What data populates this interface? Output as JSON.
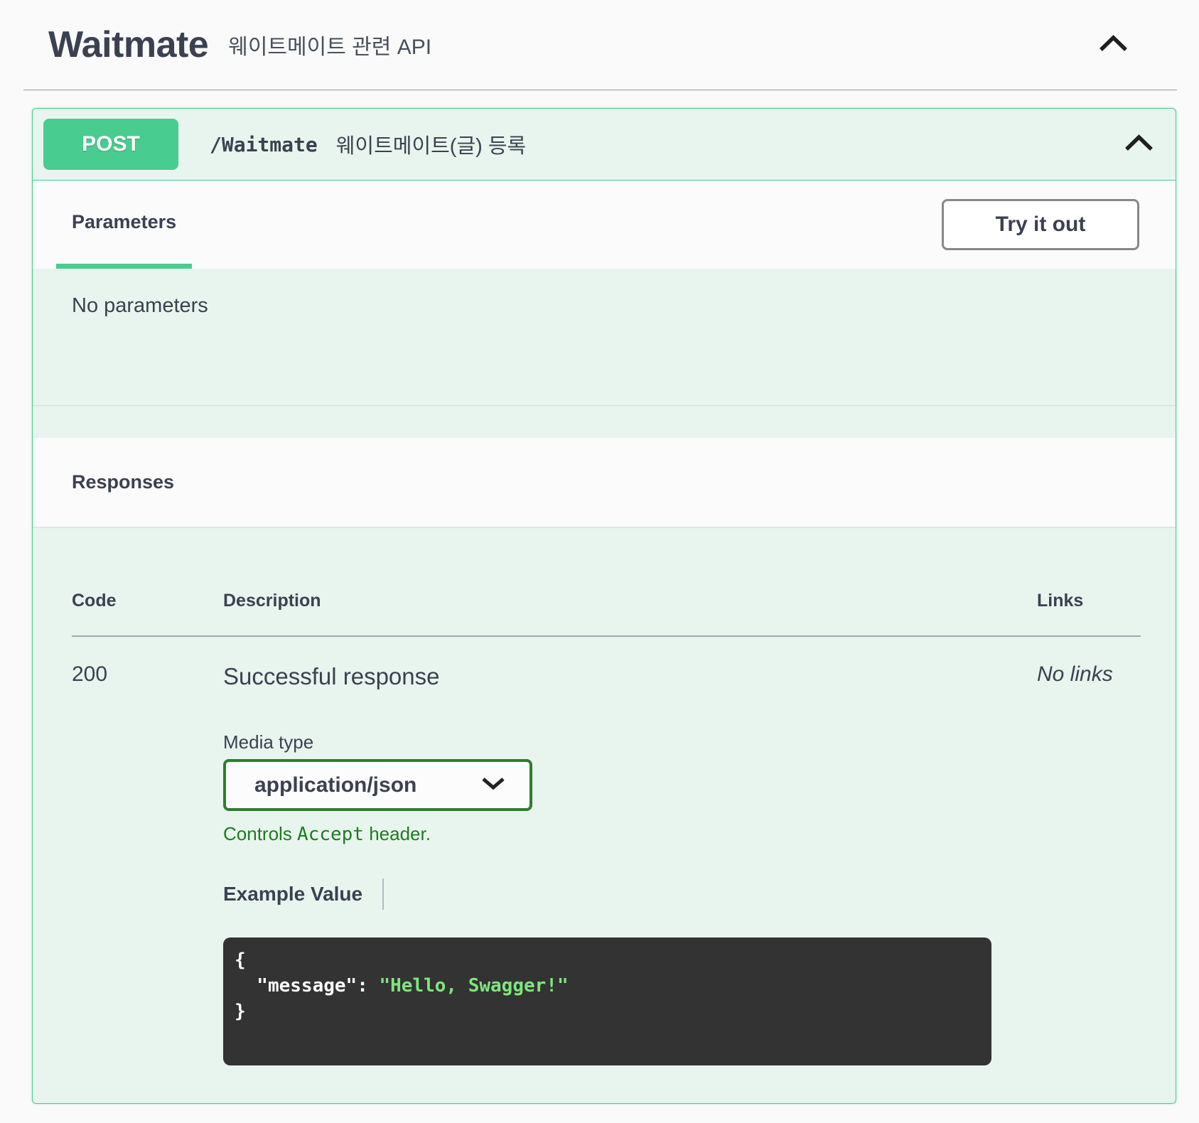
{
  "colors": {
    "accent_green": "#49cc90",
    "block_background": "#e8f5ee",
    "text": "#3b4151",
    "select_border_green": "#2d7e2d",
    "controls_text_green": "#1c7d1c",
    "code_background": "#333333",
    "code_string_green": "#7ce87c",
    "try_btn_border": "#888888"
  },
  "header": {
    "title": "Waitmate",
    "subtitle": "웨이트메이트 관련 API"
  },
  "operation": {
    "method": "POST",
    "path": "/Waitmate",
    "summary": "웨이트메이트(글) 등록"
  },
  "tabs": {
    "parameters_label": "Parameters",
    "try_it_out_label": "Try it out"
  },
  "parameters": {
    "empty_text": "No parameters"
  },
  "responses": {
    "title": "Responses",
    "headers": [
      "Code",
      "Description",
      "Links"
    ],
    "row": {
      "code": "200",
      "description": "Successful response",
      "links": "No links",
      "media_type_label": "Media type",
      "media_type_value": "application/json",
      "controls_prefix": "Controls ",
      "controls_code": "Accept",
      "controls_suffix": " header.",
      "example_tab_label": "Example Value",
      "example": {
        "open": "{",
        "key": "  \"message\"",
        "separator": ": ",
        "value": "\"Hello, Swagger!\"",
        "close": "}"
      }
    }
  }
}
